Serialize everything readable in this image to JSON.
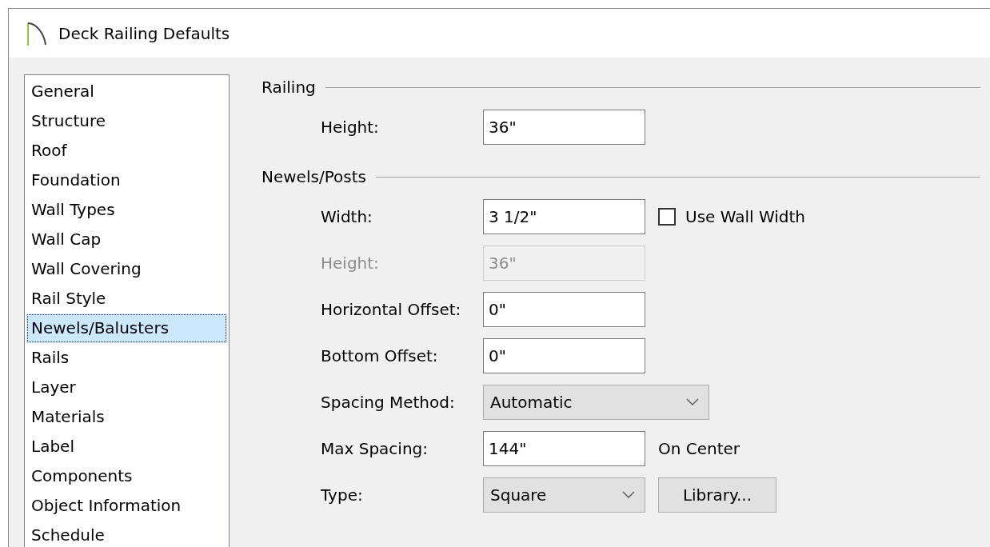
{
  "window": {
    "title": "Deck Railing Defaults"
  },
  "sidebar": {
    "items": [
      {
        "label": "General",
        "selected": false
      },
      {
        "label": "Structure",
        "selected": false
      },
      {
        "label": "Roof",
        "selected": false
      },
      {
        "label": "Foundation",
        "selected": false
      },
      {
        "label": "Wall Types",
        "selected": false
      },
      {
        "label": "Wall Cap",
        "selected": false
      },
      {
        "label": "Wall Covering",
        "selected": false
      },
      {
        "label": "Rail Style",
        "selected": false
      },
      {
        "label": "Newels/Balusters",
        "selected": true
      },
      {
        "label": "Rails",
        "selected": false
      },
      {
        "label": "Layer",
        "selected": false
      },
      {
        "label": "Materials",
        "selected": false
      },
      {
        "label": "Label",
        "selected": false
      },
      {
        "label": "Components",
        "selected": false
      },
      {
        "label": "Object Information",
        "selected": false
      },
      {
        "label": "Schedule",
        "selected": false
      }
    ]
  },
  "sections": [
    {
      "title": "Railing",
      "rows": [
        {
          "kind": "text",
          "label": "Height:",
          "value": "36\"",
          "disabled": false
        }
      ]
    },
    {
      "title": "Newels/Posts",
      "rows": [
        {
          "kind": "text",
          "label": "Width:",
          "value": "3 1/2\"",
          "disabled": false,
          "checkbox": {
            "label": "Use Wall Width",
            "checked": false
          }
        },
        {
          "kind": "text",
          "label": "Height:",
          "value": "36\"",
          "disabled": true
        },
        {
          "kind": "text",
          "label": "Horizontal Offset:",
          "value": "0\"",
          "disabled": false
        },
        {
          "kind": "text",
          "label": "Bottom Offset:",
          "value": "0\"",
          "disabled": false
        },
        {
          "kind": "dropdown",
          "label": "Spacing Method:",
          "value": "Automatic",
          "wide": true
        },
        {
          "kind": "text",
          "label": "Max Spacing:",
          "value": "144\"",
          "disabled": false,
          "note": "On Center"
        },
        {
          "kind": "dropdown",
          "label": "Type:",
          "value": "Square",
          "wide": false,
          "button": "Library..."
        }
      ]
    }
  ]
}
